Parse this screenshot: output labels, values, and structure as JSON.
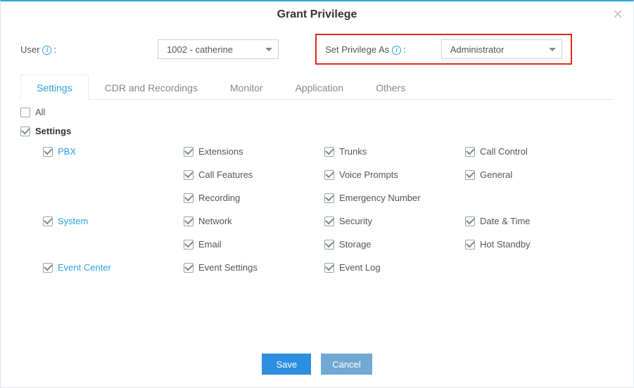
{
  "dialog": {
    "title": "Grant Privilege"
  },
  "top": {
    "user_label": "User",
    "user_value": "1002 - catherine",
    "priv_label": "Set Privilege As",
    "priv_value": "Administrator"
  },
  "tabs": [
    {
      "label": "Settings",
      "active": true
    },
    {
      "label": "CDR and Recordings",
      "active": false
    },
    {
      "label": "Monitor",
      "active": false
    },
    {
      "label": "Application",
      "active": false
    },
    {
      "label": "Others",
      "active": false
    }
  ],
  "all_label": "All",
  "settings_heading": "Settings",
  "groups": [
    {
      "name": "PBX",
      "items": [
        [
          "Extensions",
          "Trunks",
          "Call Control"
        ],
        [
          "Call Features",
          "Voice Prompts",
          "General"
        ],
        [
          "Recording",
          "Emergency Number",
          ""
        ]
      ]
    },
    {
      "name": "System",
      "items": [
        [
          "Network",
          "Security",
          "Date & Time"
        ],
        [
          "Email",
          "Storage",
          "Hot Standby"
        ]
      ]
    },
    {
      "name": "Event Center",
      "items": [
        [
          "Event Settings",
          "Event Log",
          ""
        ]
      ]
    }
  ],
  "footer": {
    "save": "Save",
    "cancel": "Cancel"
  }
}
